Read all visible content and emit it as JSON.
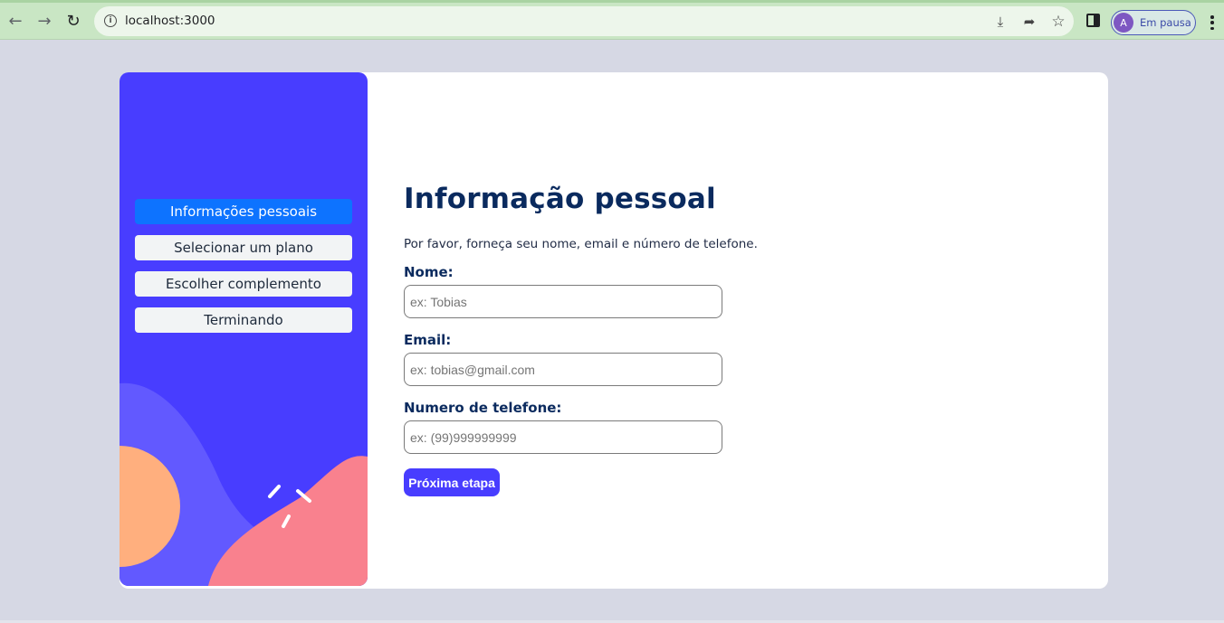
{
  "browser": {
    "url": "localhost:3000",
    "profile_initial": "A",
    "profile_status": "Em pausa"
  },
  "sidebar": {
    "steps": [
      {
        "label": "Informações pessoais",
        "active": true
      },
      {
        "label": "Selecionar um plano",
        "active": false
      },
      {
        "label": "Escolher complemento",
        "active": false
      },
      {
        "label": "Terminando",
        "active": false
      }
    ]
  },
  "form": {
    "title": "Informação pessoal",
    "subtitle": "Por favor, forneça seu nome, email e número de telefone.",
    "name_label": "Nome:",
    "name_placeholder": "ex: Tobias",
    "email_label": "Email:",
    "email_placeholder": "ex: tobias@gmail.com",
    "phone_label": "Numero de telefone:",
    "phone_placeholder": "ex: (99)999999999",
    "submit_label": "Próxima etapa"
  },
  "colors": {
    "sidebar_bg": "#483dff",
    "active_step": "#0d73ff",
    "accent": "#483dff",
    "title": "#0a2a5e"
  }
}
